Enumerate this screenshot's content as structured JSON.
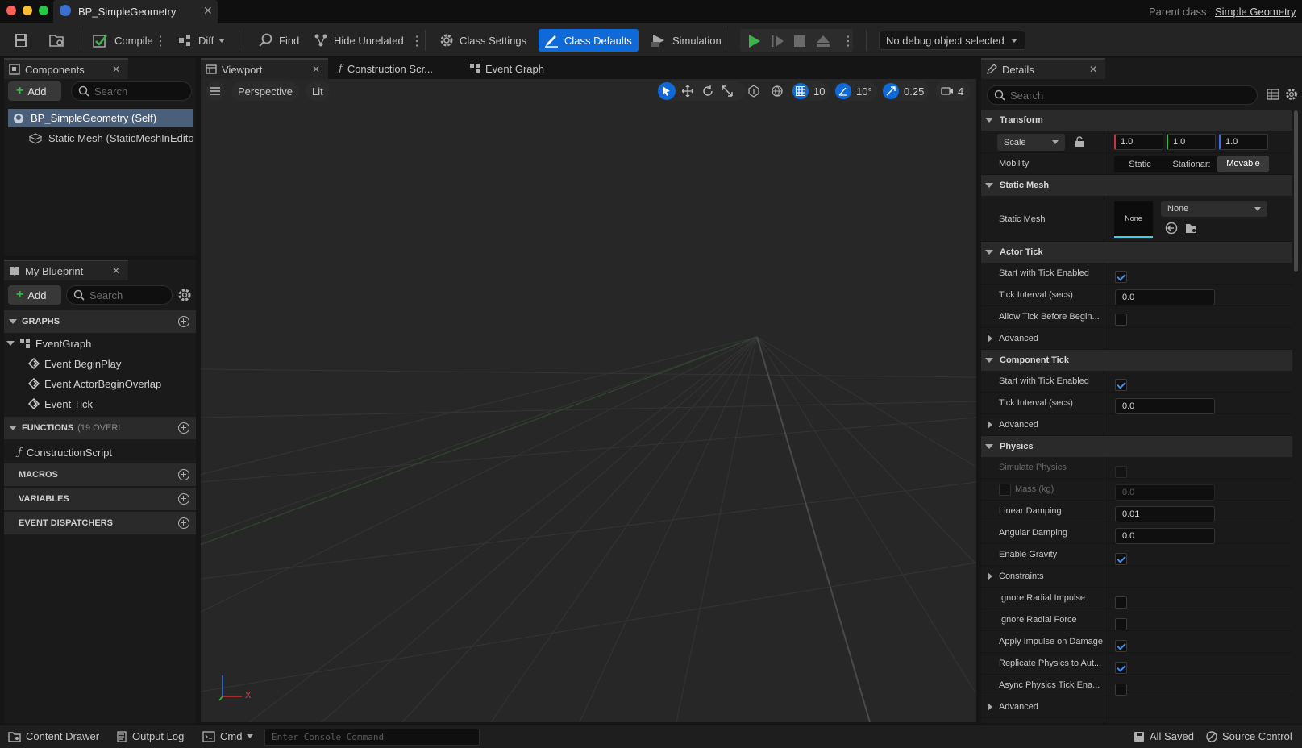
{
  "window": {
    "tab_title": "BP_SimpleGeometry",
    "parent_class_label": "Parent class:",
    "parent_class_value": "Simple Geometry"
  },
  "toolbar": {
    "compile": "Compile",
    "diff": "Diff",
    "find": "Find",
    "hide_unrelated": "Hide Unrelated",
    "class_settings": "Class Settings",
    "class_defaults": "Class Defaults",
    "simulation": "Simulation",
    "debug_selector": "No debug object selected"
  },
  "components": {
    "tab": "Components",
    "add": "Add",
    "search_placeholder": "Search",
    "items": [
      "BP_SimpleGeometry (Self)",
      "Static Mesh (StaticMeshInEdito"
    ]
  },
  "my_blueprint": {
    "tab": "My Blueprint",
    "add": "Add",
    "search_placeholder": "Search",
    "graphs_label": "GRAPHS",
    "event_graph": "EventGraph",
    "events": [
      "Event BeginPlay",
      "Event ActorBeginOverlap",
      "Event Tick"
    ],
    "functions_label": "FUNCTIONS",
    "functions_count": "(19 OVERI",
    "construction_script": "ConstructionScript",
    "macros_label": "MACROS",
    "variables_label": "VARIABLES",
    "dispatchers_label": "EVENT DISPATCHERS"
  },
  "editor_tabs": {
    "viewport": "Viewport",
    "construction": "Construction Scr...",
    "event_graph": "Event Graph"
  },
  "viewport": {
    "perspective": "Perspective",
    "lit": "Lit",
    "grid_snap": "10",
    "rot_snap": "10°",
    "scale_snap": "0.25",
    "cam_speed": "4"
  },
  "details": {
    "tab": "Details",
    "search_placeholder": "Search",
    "transform": {
      "header": "Transform",
      "scale_label": "Scale",
      "x": "1.0",
      "y": "1.0",
      "z": "1.0",
      "mobility_label": "Mobility",
      "mobility_options": [
        "Static",
        "Stationar:",
        "Movable"
      ]
    },
    "static_mesh": {
      "header": "Static Mesh",
      "label": "Static Mesh",
      "thumb": "None",
      "dropdown": "None"
    },
    "actor_tick": {
      "header": "Actor Tick",
      "start_enabled": "Start with Tick Enabled",
      "interval": "Tick Interval (secs)",
      "interval_value": "0.0",
      "allow_before": "Allow Tick Before Begin...",
      "advanced": "Advanced"
    },
    "component_tick": {
      "header": "Component Tick",
      "start_enabled": "Start with Tick Enabled",
      "interval": "Tick Interval (secs)",
      "interval_value": "0.0",
      "advanced": "Advanced"
    },
    "physics": {
      "header": "Physics",
      "simulate": "Simulate Physics",
      "mass": "Mass (kg)",
      "mass_value": "0.0",
      "linear": "Linear Damping",
      "linear_value": "0.01",
      "angular": "Angular Damping",
      "angular_value": "0.0",
      "gravity": "Enable Gravity",
      "constraints": "Constraints",
      "ignore_impulse": "Ignore Radial Impulse",
      "ignore_force": "Ignore Radial Force",
      "apply_impulse": "Apply Impulse on Damage",
      "replicate": "Replicate Physics to Aut...",
      "async": "Async Physics Tick Ena...",
      "advanced": "Advanced"
    }
  },
  "statusbar": {
    "content_drawer": "Content Drawer",
    "output_log": "Output Log",
    "cmd": "Cmd",
    "console_placeholder": "Enter Console Command",
    "all_saved": "All Saved",
    "source_control": "Source Control"
  },
  "axis": {
    "x": "X"
  },
  "colors": {
    "accent": "#0f6ad8",
    "play": "#3bb54a",
    "check": "#3a8ef6",
    "mesh_underline": "#3ad1e6"
  }
}
